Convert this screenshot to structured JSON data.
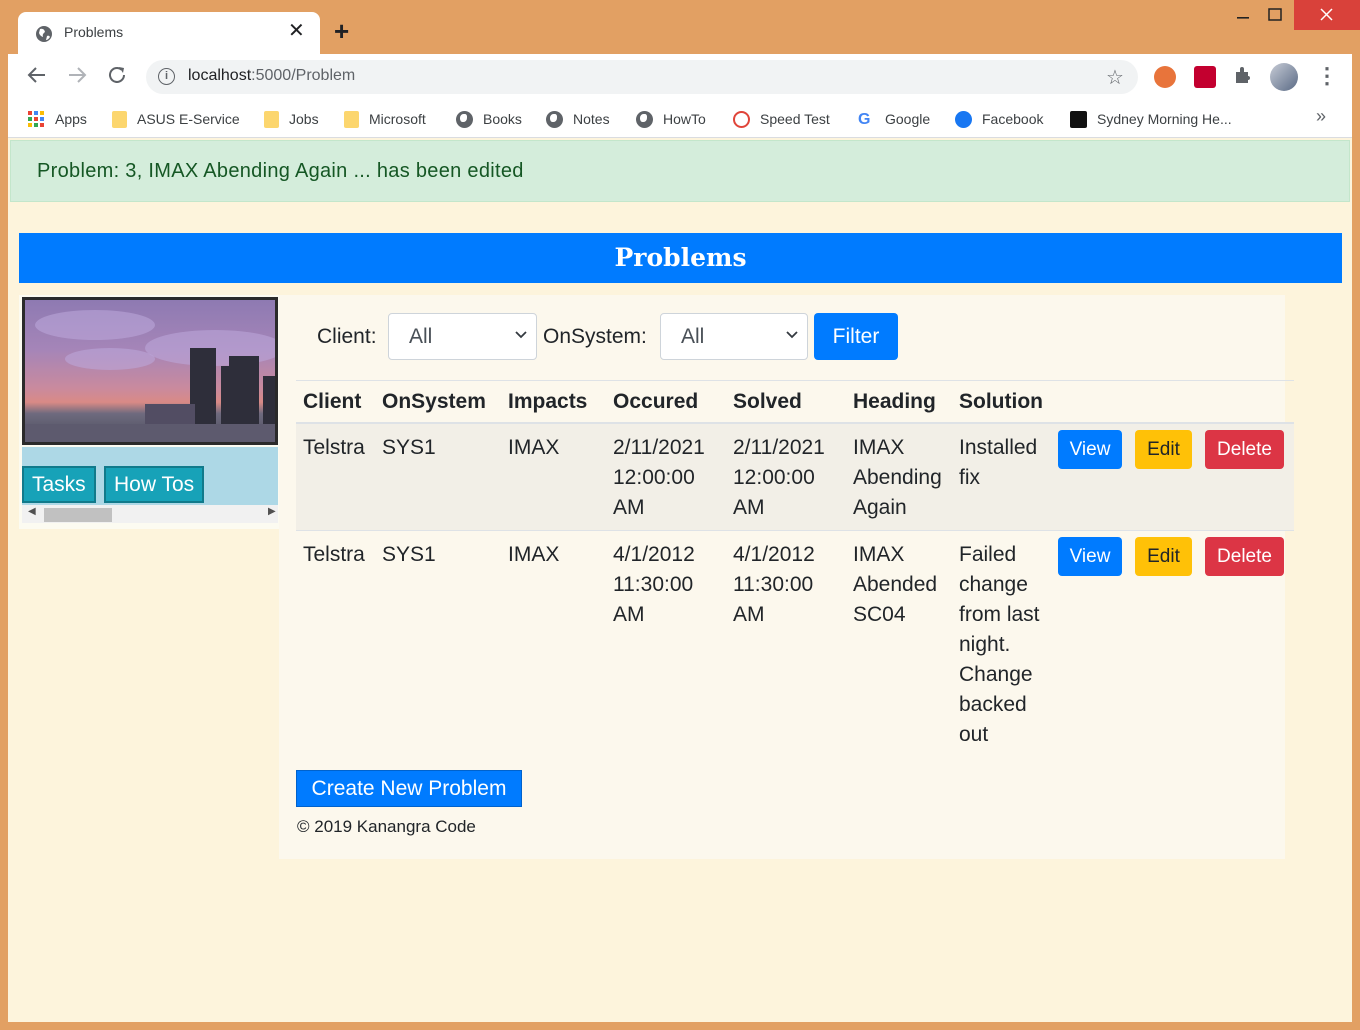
{
  "browser": {
    "tab_title": "Problems",
    "url_host": "localhost",
    "url_path": ":5000/Problem",
    "bookmarks": [
      "Apps",
      "ASUS E-Service",
      "Jobs",
      "Microsoft",
      "Books",
      "Notes",
      "HowTo",
      "Speed Test",
      "Google",
      "Facebook",
      "Sydney Morning He..."
    ],
    "bookmarks_more": "»"
  },
  "alert": {
    "message": "Problem: 3, IMAX Abending Again ... has been edited"
  },
  "page": {
    "title": "Problems"
  },
  "sidebar": {
    "tasks_label": "Tasks",
    "howtos_label": "How Tos"
  },
  "filter": {
    "client_label": "Client:",
    "client_value": "All",
    "onsystem_label": "OnSystem:",
    "onsystem_value": "All",
    "button_label": "Filter"
  },
  "table": {
    "columns": [
      "Client",
      "OnSystem",
      "Impacts",
      "Occured",
      "Solved",
      "Heading",
      "Solution"
    ],
    "rows": [
      {
        "client": "Telstra",
        "onsystem": "SYS1",
        "impacts": "IMAX",
        "occured": "2/11/2021 12:00:00 AM",
        "solved": "2/11/2021 12:00:00 AM",
        "heading": "IMAX Abending Again",
        "solution": "Installed fix"
      },
      {
        "client": "Telstra",
        "onsystem": "SYS1",
        "impacts": "IMAX",
        "occured": "4/1/2012 11:30:00 AM",
        "solved": "4/1/2012 11:30:00 AM",
        "heading": "IMAX Abended SC04",
        "solution": "Failed change from last night. Change backed out"
      }
    ],
    "actions": {
      "view": "View",
      "edit": "Edit",
      "delete": "Delete"
    }
  },
  "create_button": "Create New Problem",
  "footer": "© 2019 Kanangra Code",
  "colors": {
    "primary": "#007bff",
    "warning": "#ffc107",
    "danger": "#dc3545",
    "info": "#17a2b8",
    "alert_bg": "#d4eddb",
    "page_bg": "#fdf4dc",
    "frame": "#e2a063"
  }
}
